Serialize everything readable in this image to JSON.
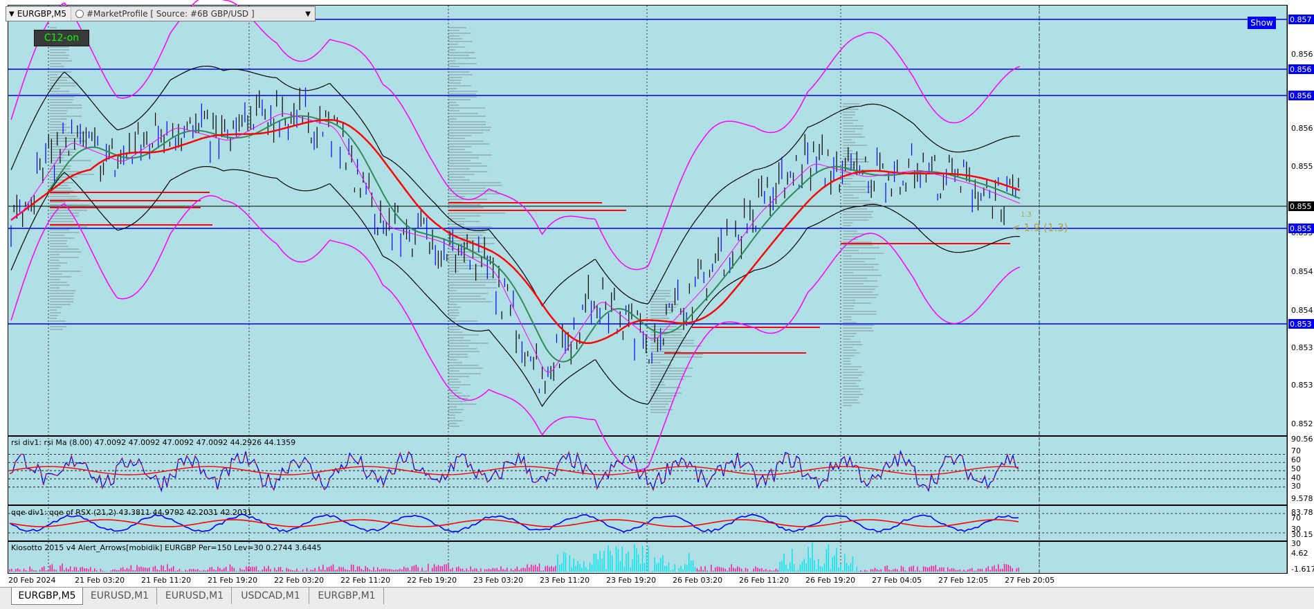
{
  "window": {
    "symbol_title": "EURGBP,M5",
    "profile_title": "#MarketProfile [ Source: #6B GBP/USD ]"
  },
  "buttons": {
    "c12": "C12-on",
    "show": "Show"
  },
  "chart_data": [
    {
      "type": "line",
      "title": "EURGBP,M5",
      "x": [
        "20 Feb 2024",
        "21 Feb 03:20",
        "21 Feb 11:20",
        "21 Feb 19:20",
        "22 Feb 03:20",
        "22 Feb 11:20",
        "22 Feb 19:20",
        "23 Feb 03:20",
        "23 Feb 11:20",
        "23 Feb 19:20",
        "26 Feb 03:20",
        "26 Feb 11:20",
        "26 Feb 19:20",
        "27 Feb 04:05",
        "27 Feb 12:05",
        "27 Feb 20:05"
      ],
      "ylim": [
        0.8519,
        0.8575
      ],
      "y_ticks": [
        "0.857",
        "0.856",
        "0.856",
        "0.856",
        "0.855",
        "0.855",
        "0.855",
        "0.854",
        "0.854",
        "0.853",
        "0.853",
        "0.852"
      ],
      "price_markers": [
        "0.857",
        "0.856",
        "0.856",
        "0.855",
        "0.855",
        "0.853"
      ],
      "horizontal_levels": [
        0.8572,
        0.8567,
        0.8563,
        0.8544,
        0.8549,
        0.8547
      ],
      "annotation": "< 1.9 (1.3)",
      "annotation_small": "1.3",
      "series": [
        {
          "values": [
            0.8547,
            0.8558,
            0.8555,
            0.856,
            0.8558,
            0.8562,
            0.856,
            0.8546,
            0.8544,
            0.854,
            0.8525,
            0.8536,
            0.853,
            0.8538,
            0.8548,
            0.8555,
            0.8553,
            0.8554,
            0.8552,
            0.8549
          ]
        }
      ],
      "colors": {
        "price": "#0000ff",
        "bands": "#000000",
        "outer_bands": "#ff00ff",
        "ma_slow": "#ff0000",
        "ma_mid": "#2e8b57",
        "levels": "#0000ff",
        "profile": "#000000"
      }
    },
    {
      "type": "line",
      "title": "rsi div1: rsi Ma (8.00) 47.0092 47.0092 47.0092 47.0092 44.2926 44.1359",
      "ylim": [
        9.578,
        90.56
      ],
      "y_ticks": [
        "90.56",
        "70",
        "60",
        "50",
        "40",
        "30",
        "9.578"
      ],
      "colors": {
        "rsi": "#0000ff",
        "rsi_neg": "#ff0000",
        "ma": "#ff0000"
      }
    },
    {
      "type": "line",
      "title": "qqe div1: qqe of RSX (21,2) 43.3811 44.9792 42.2031 42.2031",
      "ylim": [
        30.15,
        83.78
      ],
      "y_ticks": [
        "83.78",
        "70",
        "30",
        "30.15"
      ],
      "colors": {
        "fast": "#0000ff",
        "slow": "#ff0000"
      }
    },
    {
      "type": "bar",
      "title": "Kiosotto 2015 v4 Alert_Arrows[mobidik] EURGBP Per=150 Lev=30 0.2744 3.6445",
      "y_ticks": [
        "30",
        "4.62",
        "-1.617"
      ],
      "colors": {
        "bull": "#00e5ee",
        "bear": "#ff1493"
      }
    }
  ],
  "tabs": [
    {
      "label": "EURGBP,M5"
    },
    {
      "label": "EURUSD,M1"
    },
    {
      "label": "EURUSD,M1"
    },
    {
      "label": "USDCAD,M1"
    },
    {
      "label": "EURGBP,M1"
    }
  ]
}
